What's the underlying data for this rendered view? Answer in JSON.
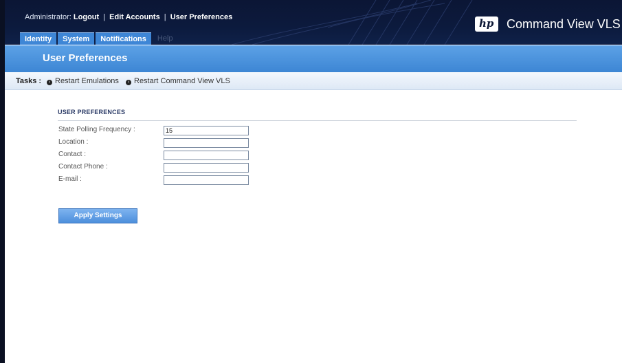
{
  "header": {
    "admin_prefix": "Administrator:",
    "logout": "Logout",
    "edit_accounts": "Edit Accounts",
    "user_preferences": "User Preferences",
    "separator": "|",
    "brand_logo": "hp",
    "brand_title": "Command View VLS"
  },
  "tabs": [
    {
      "label": "Identity"
    },
    {
      "label": "System"
    },
    {
      "label": "Notifications"
    },
    {
      "label": "Help"
    }
  ],
  "page_title": "User Preferences",
  "tasks": {
    "label": "Tasks :",
    "items": [
      {
        "label": "Restart Emulations"
      },
      {
        "label": "Restart Command View VLS"
      }
    ]
  },
  "form": {
    "section_title": "USER PREFERENCES",
    "fields": [
      {
        "label": "State Polling Frequency :",
        "value": "15"
      },
      {
        "label": "Location :",
        "value": ""
      },
      {
        "label": "Contact :",
        "value": ""
      },
      {
        "label": "Contact Phone :",
        "value": ""
      },
      {
        "label": "E-mail :",
        "value": ""
      }
    ],
    "apply_button": "Apply Settings"
  },
  "colors": {
    "header_bg": "#0b1635",
    "accent_blue": "#3e86d6",
    "title_bar_blue": "#4a90dc"
  }
}
